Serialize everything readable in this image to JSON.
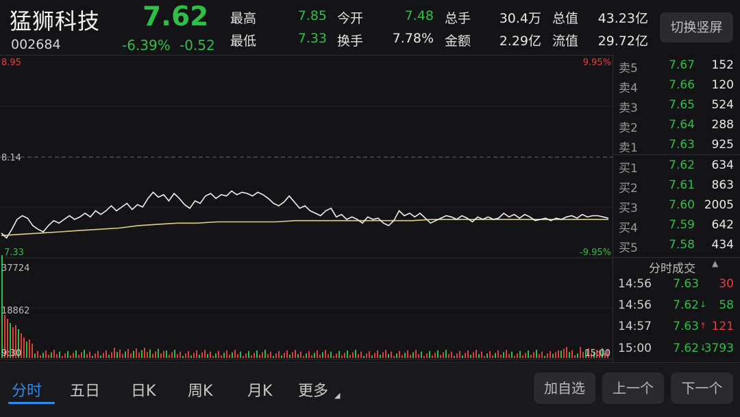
{
  "header": {
    "name": "猛狮科技",
    "code": "002684",
    "price": "7.62",
    "change_pct": "-6.39%",
    "change_abs": "-0.52",
    "quote": [
      {
        "label": "最高",
        "value": "7.85",
        "color": "#2fbe48"
      },
      {
        "label": "今开",
        "value": "7.48",
        "color": "#2fbe48"
      },
      {
        "label": "总手",
        "value": "30.4万",
        "color": "#e8e8e8"
      },
      {
        "label": "总值",
        "value": "43.23亿",
        "color": "#e8e8e8"
      },
      {
        "label": "最低",
        "value": "7.33",
        "color": "#2fbe48"
      },
      {
        "label": "换手",
        "value": "7.78%",
        "color": "#e8e8e8"
      },
      {
        "label": "金额",
        "value": "2.29亿",
        "color": "#e8e8e8"
      },
      {
        "label": "流值",
        "value": "29.72亿",
        "color": "#e8e8e8"
      }
    ],
    "switch_label": "切换竖屏"
  },
  "chart": {
    "top_price": "8.95",
    "top_pct": "9.95%",
    "mid_price": "8.14",
    "bottom_price": "7.33",
    "bottom_pct": "-9.95%",
    "vol_max": "37724",
    "vol_mid": "18862",
    "time_start": "9:30",
    "time_end": "15:00"
  },
  "chart_data": {
    "type": "line",
    "ylim": [
      7.33,
      8.95
    ],
    "prev_close": 8.14,
    "series": [
      {
        "values": [
          7.52,
          7.48,
          7.55,
          7.63,
          7.66,
          7.64,
          7.58,
          7.55,
          7.53,
          7.58,
          7.62,
          7.6,
          7.63,
          7.66,
          7.63,
          7.65,
          7.68,
          7.65,
          7.7,
          7.67,
          7.7,
          7.74,
          7.7,
          7.73,
          7.76,
          7.71,
          7.75,
          7.73,
          7.8,
          7.85,
          7.81,
          7.83,
          7.78,
          7.84,
          7.8,
          7.75,
          7.72,
          7.78,
          7.76,
          7.82,
          7.84,
          7.8,
          7.83,
          7.82,
          7.86,
          7.83,
          7.85,
          7.84,
          7.82,
          7.85,
          7.83,
          7.8,
          7.76,
          7.74,
          7.77,
          7.82,
          7.77,
          7.72,
          7.74,
          7.7,
          7.68,
          7.66,
          7.7,
          7.72,
          7.65,
          7.67,
          7.63,
          7.65,
          7.63,
          7.6,
          7.65,
          7.63,
          7.64,
          7.6,
          7.58,
          7.62,
          7.7,
          7.66,
          7.68,
          7.65,
          7.68,
          7.64,
          7.6,
          7.62,
          7.64,
          7.66,
          7.65,
          7.63,
          7.66,
          7.64,
          7.61,
          7.65,
          7.63,
          7.65,
          7.63,
          7.64,
          7.68,
          7.65,
          7.67,
          7.64,
          7.67,
          7.65,
          7.62,
          7.63,
          7.64,
          7.62,
          7.64,
          7.63,
          7.65,
          7.66,
          7.64,
          7.67,
          7.65,
          7.66,
          7.66,
          7.65,
          7.64
        ]
      },
      {
        "values": [
          7.5,
          7.51,
          7.52,
          7.53,
          7.54,
          7.55,
          7.56,
          7.58,
          7.59,
          7.6,
          7.6,
          7.61,
          7.61,
          7.61,
          7.61,
          7.62,
          7.62,
          7.62,
          7.62,
          7.62,
          7.62,
          7.62,
          7.63,
          7.63,
          7.63,
          7.63,
          7.63,
          7.63,
          7.63,
          7.63,
          7.63,
          7.63
        ]
      }
    ]
  },
  "orderbook": {
    "asks": [
      {
        "label": "卖5",
        "price": "7.67",
        "vol": "152"
      },
      {
        "label": "卖4",
        "price": "7.66",
        "vol": "120"
      },
      {
        "label": "卖3",
        "price": "7.65",
        "vol": "524"
      },
      {
        "label": "卖2",
        "price": "7.64",
        "vol": "288"
      },
      {
        "label": "卖1",
        "price": "7.63",
        "vol": "925"
      }
    ],
    "bids": [
      {
        "label": "买1",
        "price": "7.62",
        "vol": "634"
      },
      {
        "label": "买2",
        "price": "7.61",
        "vol": "863"
      },
      {
        "label": "买3",
        "price": "7.60",
        "vol": "2005"
      },
      {
        "label": "买4",
        "price": "7.59",
        "vol": "642"
      },
      {
        "label": "买5",
        "price": "7.58",
        "vol": "434"
      }
    ]
  },
  "ticks": {
    "title": "分时成交",
    "items": [
      {
        "time": "14:56",
        "price": "7.63",
        "arrow": "",
        "vol": "30",
        "vol_color": "#e43e3e"
      },
      {
        "time": "14:56",
        "price": "7.62",
        "arrow": "↓",
        "vol": "58",
        "vol_color": "#2fbe48"
      },
      {
        "time": "14:57",
        "price": "7.63",
        "arrow": "↑",
        "vol": "121",
        "vol_color": "#e43e3e"
      },
      {
        "time": "15:00",
        "price": "7.62",
        "arrow": "↓",
        "vol": "3793",
        "vol_color": "#2fbe48"
      }
    ]
  },
  "tabs": [
    "分时",
    "五日",
    "日K",
    "周K",
    "月K",
    "更多"
  ],
  "buttons": {
    "add": "加自选",
    "prev": "上一个",
    "next": "下一个"
  }
}
